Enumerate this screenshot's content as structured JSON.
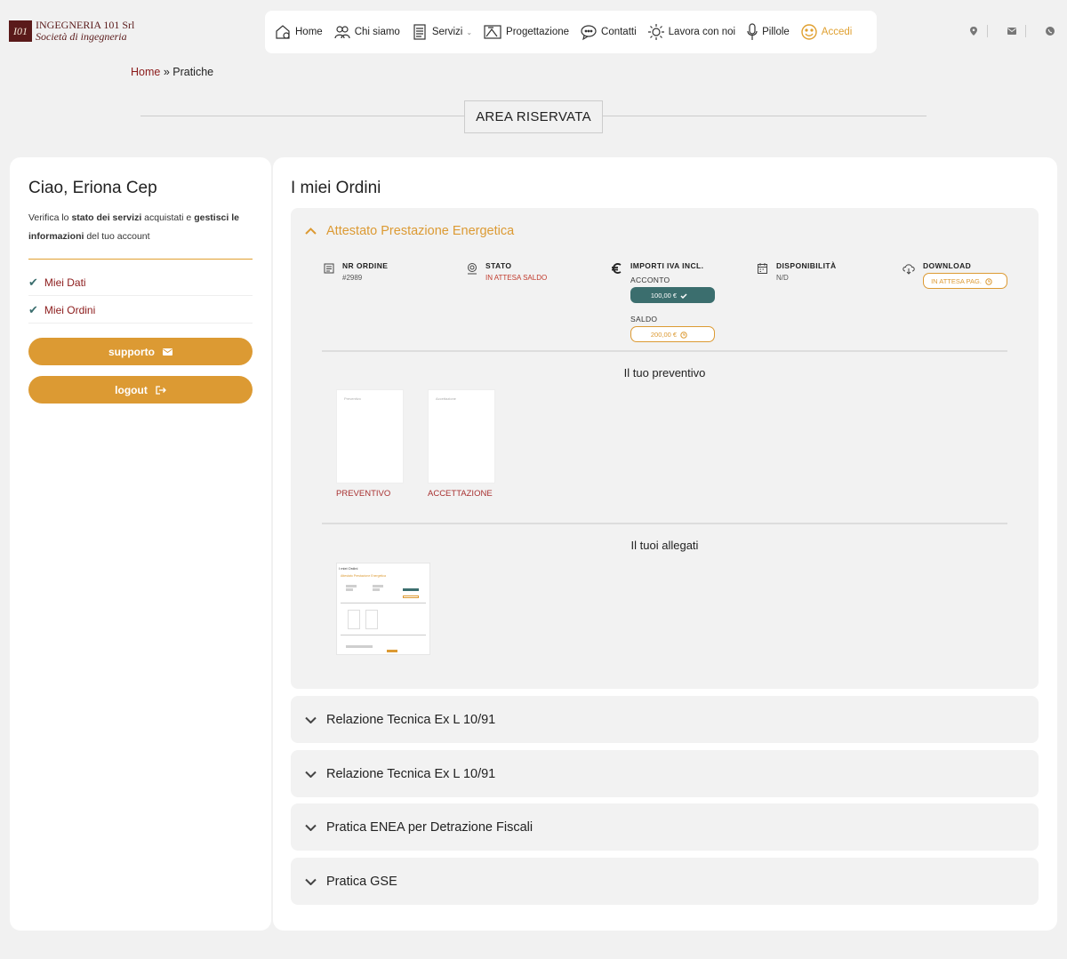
{
  "brand": {
    "mark": "I01",
    "line1": "INGEGNERIA 101 Srl",
    "line2": "Società di ingegneria"
  },
  "nav": {
    "items": [
      {
        "label": "Home",
        "icon": "home-icon"
      },
      {
        "label": "Chi siamo",
        "icon": "users-icon"
      },
      {
        "label": "Servizi",
        "icon": "list-icon",
        "chevron": "⌄"
      },
      {
        "label": "Progettazione",
        "icon": "blueprint-icon"
      },
      {
        "label": "Contatti",
        "icon": "chat-icon"
      },
      {
        "label": "Lavora con noi",
        "icon": "gear-icon"
      },
      {
        "label": "Pillole",
        "icon": "microphone-icon"
      },
      {
        "label": "Accedi",
        "icon": "smiley-icon"
      }
    ],
    "accent_color": "#e0a030"
  },
  "header_icons": [
    "location-icon",
    "mail-icon",
    "whatsapp-icon"
  ],
  "breadcrumb": {
    "home": "Home",
    "separator": " » ",
    "current": "Pratiche"
  },
  "page_title": "AREA RISERVATA",
  "sidebar": {
    "greeting": "Ciao, Eriona Cep",
    "intro_parts": [
      "Verifica lo ",
      "stato dei servizi",
      " acquistati e ",
      "gestisci le informazioni",
      " del tuo account"
    ],
    "menu": [
      {
        "label": "Miei Dati"
      },
      {
        "label": "Miei Ordini"
      }
    ],
    "buttons": {
      "support": "supporto",
      "logout": "logout"
    },
    "button_color": "#dc9a33"
  },
  "orders": {
    "title": "I miei Ordini",
    "open_order": {
      "name": "Attestato Prestazione Energetica",
      "fields": {
        "order_label": "NR ORDINE",
        "order_value": "#2989",
        "status_label": "STATO",
        "status_value": "IN ATTESA SALDO",
        "amounts_label": "IMPORTI IVA INCL.",
        "deposit_label": "ACCONTO",
        "deposit_value": "100,00 €",
        "balance_label": "SALDO",
        "balance_value": "200,00 €",
        "availability_label": "DISPONIBILITÀ",
        "availability_value": "N/D",
        "download_label": "DOWNLOAD",
        "download_value": "IN ATTESA PAG."
      },
      "quote_section": "Il tuo preventivo",
      "documents": [
        {
          "label": "PREVENTIVO",
          "thumb_text": "Preventivo"
        },
        {
          "label": "ACCETTAZIONE",
          "thumb_text": "Accettazione"
        }
      ],
      "attachments_section": "Il tuoi allegati",
      "attachment_thumb": {
        "title": "I miei Ordini",
        "head": "Attestato Prestazione Energetica"
      }
    },
    "closed_orders": [
      {
        "name": "Relazione Tecnica Ex L 10/91"
      },
      {
        "name": "Relazione Tecnica Ex L 10/91"
      },
      {
        "name": "Pratica ENEA per Detrazione Fiscali"
      },
      {
        "name": "Pratica GSE"
      }
    ],
    "colors": {
      "paid": "#3b6e6e",
      "pending": "#dc9a33",
      "status_red": "#c0392b"
    }
  }
}
